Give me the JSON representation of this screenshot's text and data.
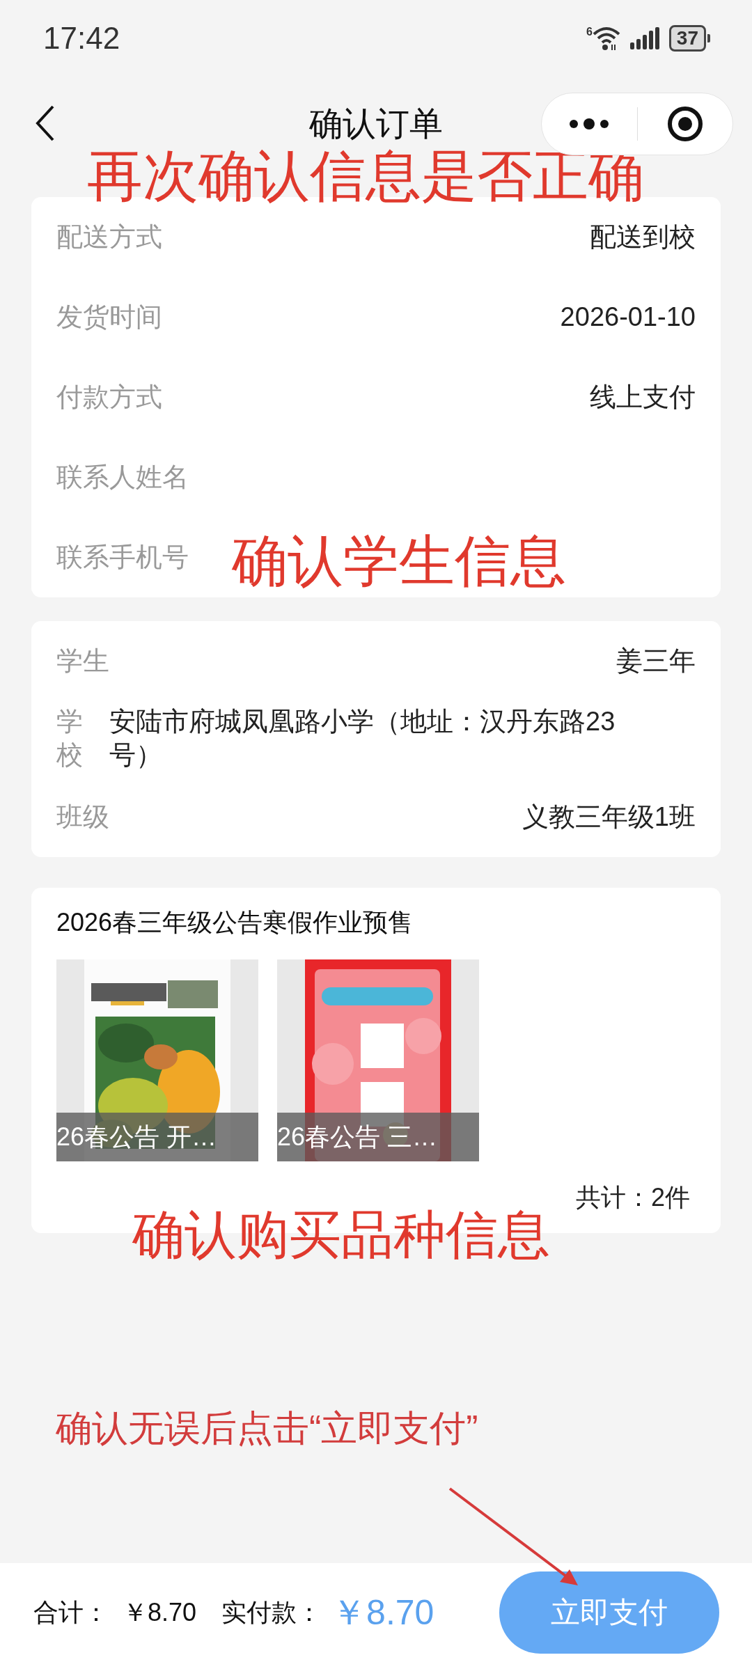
{
  "status_bar": {
    "time": "17:42",
    "network_label": "6",
    "battery": "37"
  },
  "nav_bar": {
    "title": "确认订单"
  },
  "order_info": {
    "rows": [
      {
        "label": "配送方式",
        "value": "配送到校"
      },
      {
        "label": "发货时间",
        "value": "2026-01-10"
      },
      {
        "label": "付款方式",
        "value": "线上支付"
      },
      {
        "label": "联系人姓名"
      },
      {
        "label": "联系手机号"
      }
    ]
  },
  "student_info": {
    "rows": [
      {
        "kind": "inline",
        "label": "学生",
        "value": "姜三年"
      },
      {
        "kind": "block",
        "label": "学校",
        "value": "安陆市府城凤凰路小学（地址：汉丹东路23号）"
      },
      {
        "kind": "inline",
        "label": "班级",
        "value": "义教三年级1班"
      }
    ]
  },
  "products": {
    "title": "2026春三年级公告寒假作业预售",
    "items": [
      {
        "kind": "picture",
        "caption": "26春公告 开…"
      },
      {
        "kind": "picture",
        "caption": "26春公告 三…"
      }
    ],
    "total": "共计：2件"
  },
  "pay_bar": {
    "total_label": "合计：",
    "total": "￥8.70",
    "paid_label": "实付款：",
    "paid": "￥8.70",
    "button": "立即支付"
  },
  "annotations": [
    {
      "kind": "big",
      "text": "再次确认信息是否正确"
    },
    {
      "kind": "big",
      "text": "确认学生信息"
    },
    {
      "kind": "big",
      "text": "确认购买品种信息"
    },
    {
      "kind": "small",
      "text": "确认无误后点击“立即支付”"
    }
  ]
}
